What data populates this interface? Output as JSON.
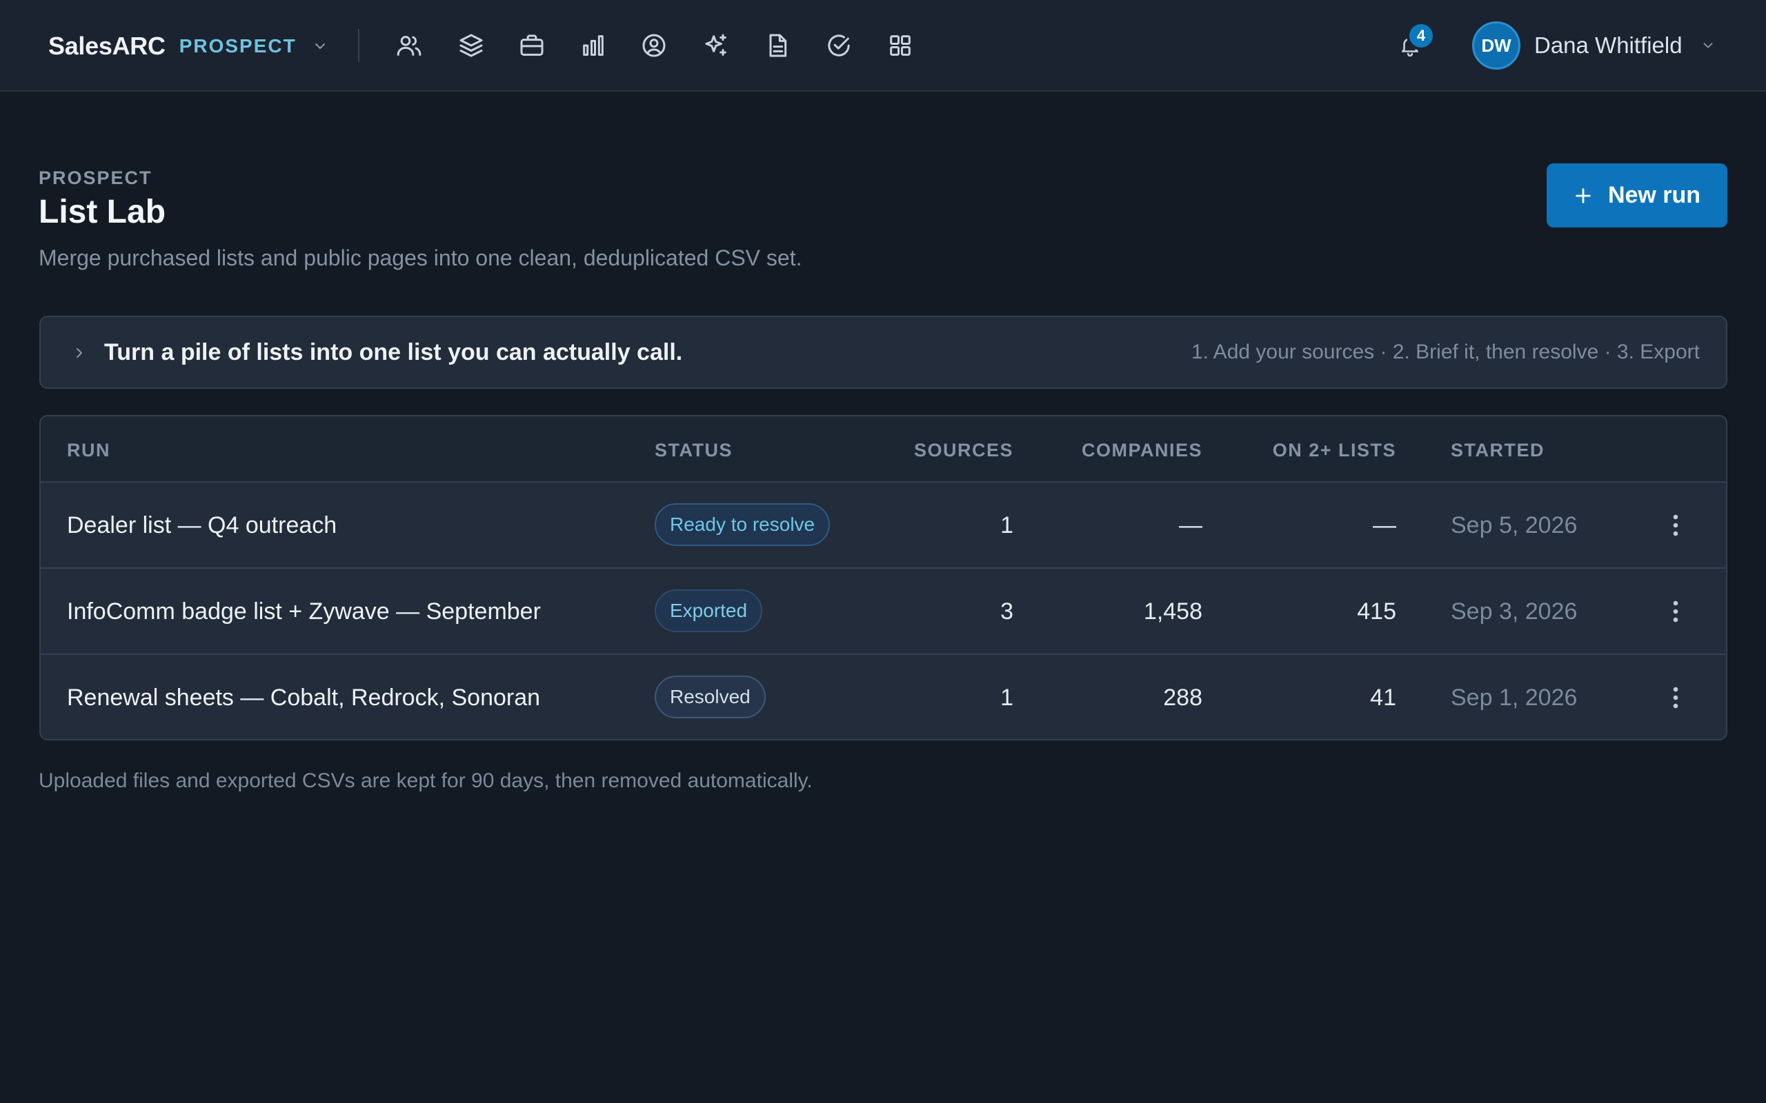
{
  "topbar": {
    "brand": "SalesARC",
    "product": "PROSPECT",
    "nav_icons": [
      "people-icon",
      "layers-icon",
      "briefcase-icon",
      "bar-chart-icon",
      "user-circle-icon",
      "sparkles-icon",
      "document-icon",
      "check-circle-icon",
      "grid-icon"
    ],
    "notifications_count": "4",
    "user": {
      "initials": "DW",
      "name": "Dana Whitfield"
    }
  },
  "header": {
    "eyebrow": "PROSPECT",
    "title": "List Lab",
    "subtitle": "Merge purchased lists and public pages into one clean, deduplicated CSV set.",
    "new_run_label": "New run"
  },
  "banner": {
    "title": "Turn a pile of lists into one list you can actually call.",
    "steps": "1. Add your sources · 2. Brief it, then resolve · 3. Export"
  },
  "table": {
    "columns": {
      "run": "RUN",
      "status": "STATUS",
      "sources": "SOURCES",
      "companies": "COMPANIES",
      "on_multiple": "ON 2+ LISTS",
      "started": "STARTED"
    },
    "rows": [
      {
        "run": "Dealer list — Q4 outreach",
        "status": "Ready to resolve",
        "sources": "1",
        "companies": "—",
        "on_multiple": "—",
        "started": "Sep 5, 2026"
      },
      {
        "run": "InfoComm badge list + Zywave — September",
        "status": "Exported",
        "sources": "3",
        "companies": "1,458",
        "on_multiple": "415",
        "started": "Sep 3, 2026"
      },
      {
        "run": "Renewal sheets — Cobalt, Redrock, Sonoran",
        "status": "Resolved",
        "sources": "1",
        "companies": "288",
        "on_multiple": "41",
        "started": "Sep 1, 2026"
      }
    ]
  },
  "footnote": "Uploaded files and exported CSVs are kept for 90 days, then removed automatically.",
  "colors": {
    "accent": "#0d74bb",
    "product": "#6ec3df",
    "background": "#131a24"
  }
}
